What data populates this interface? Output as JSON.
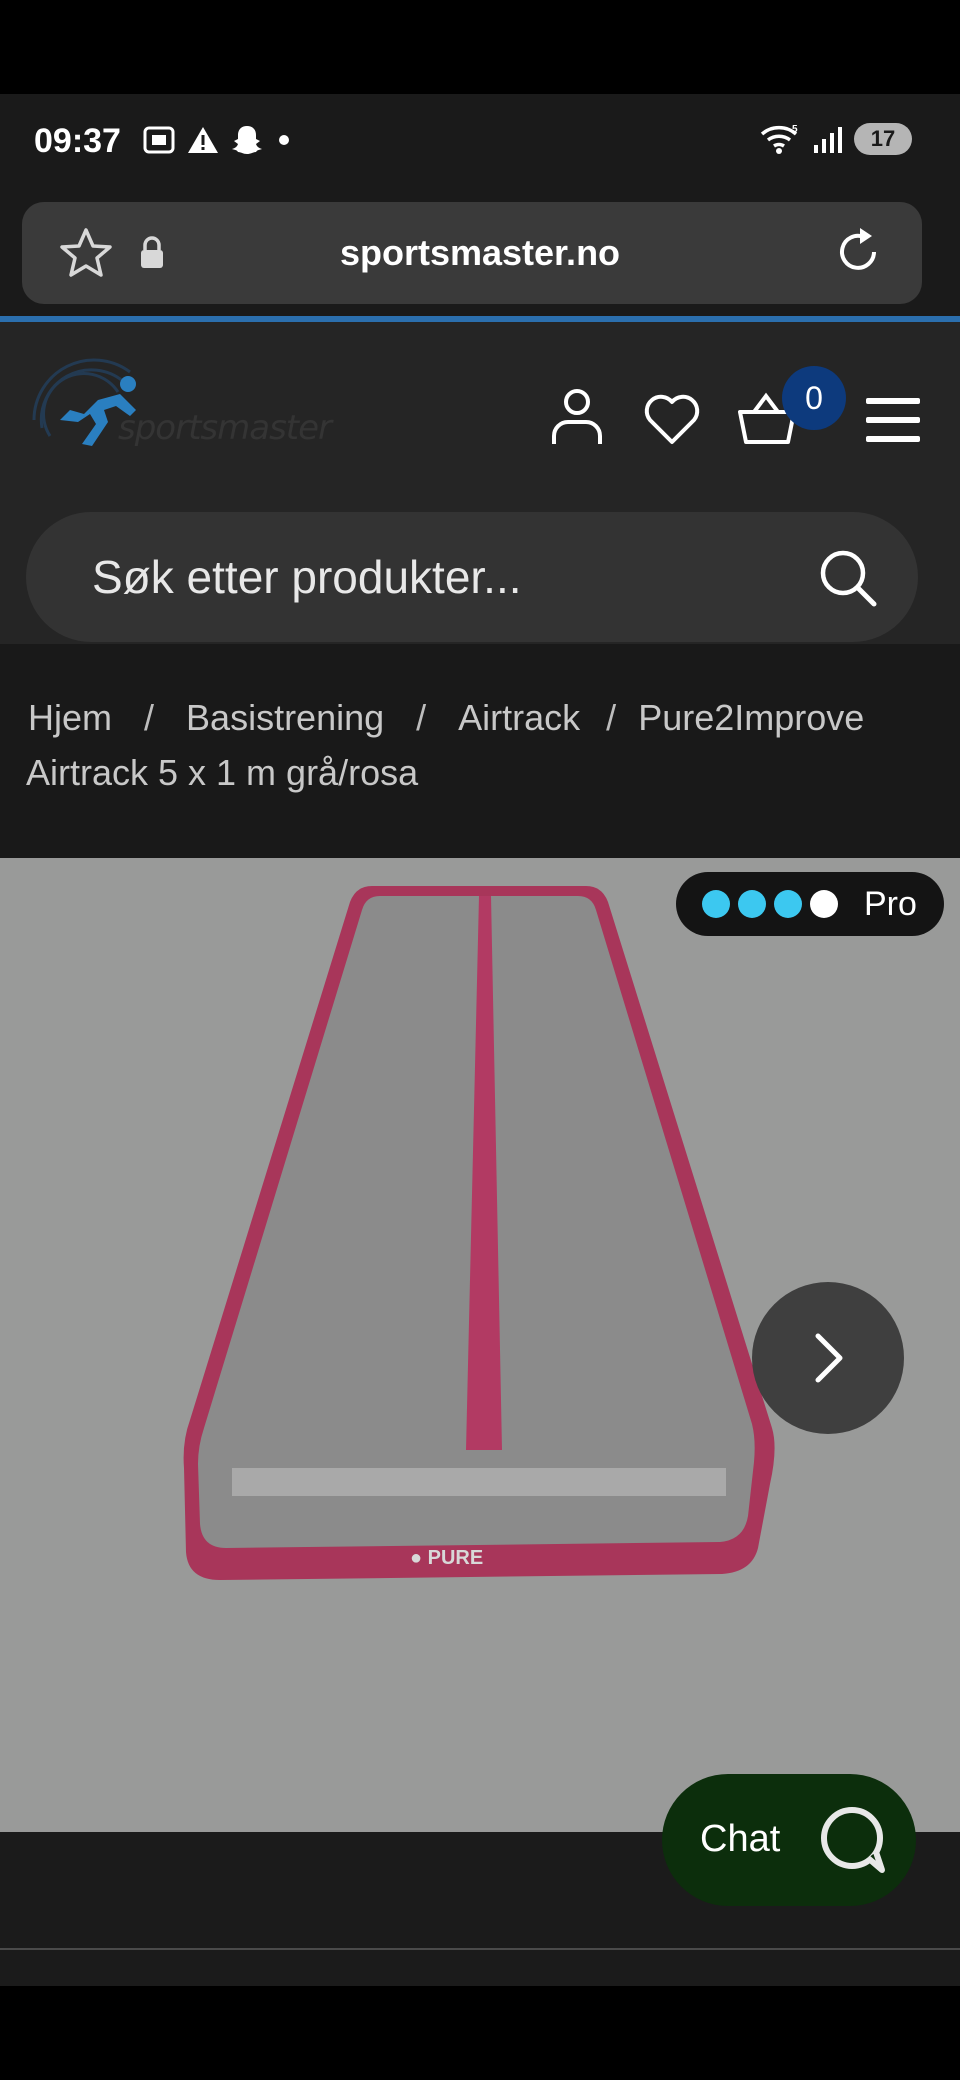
{
  "status_bar": {
    "time": "09:37",
    "battery": "17",
    "icons_left": [
      "screenshot-icon",
      "alert-icon",
      "snapchat-icon",
      "dot-icon"
    ],
    "icons_right": [
      "wifi-icon",
      "signal-icon",
      "battery-icon"
    ]
  },
  "browser": {
    "url": "sportsmaster.no",
    "icons": [
      "star-icon",
      "lock-icon",
      "reload-icon"
    ]
  },
  "header": {
    "logo_text": "sportsmaster",
    "cart_count": "0",
    "icons": [
      "account-icon",
      "heart-icon",
      "cart-icon",
      "menu-icon"
    ],
    "search_placeholder": "Søk etter produkter..."
  },
  "breadcrumb": {
    "items": [
      "Hjem",
      "Basistrening",
      "Airtrack",
      "Pure2Improve"
    ],
    "separator": "/",
    "current": "Airtrack 5 x 1 m grå/rosa"
  },
  "product": {
    "level_label": "Pro",
    "level": 3,
    "level_max": 4,
    "colors": {
      "active_dot": "#3cc8f0",
      "inactive_dot": "#ffffff",
      "mat": "#8c8c8c",
      "edge": "#b03a5e"
    }
  },
  "chat": {
    "label": "Chat"
  }
}
